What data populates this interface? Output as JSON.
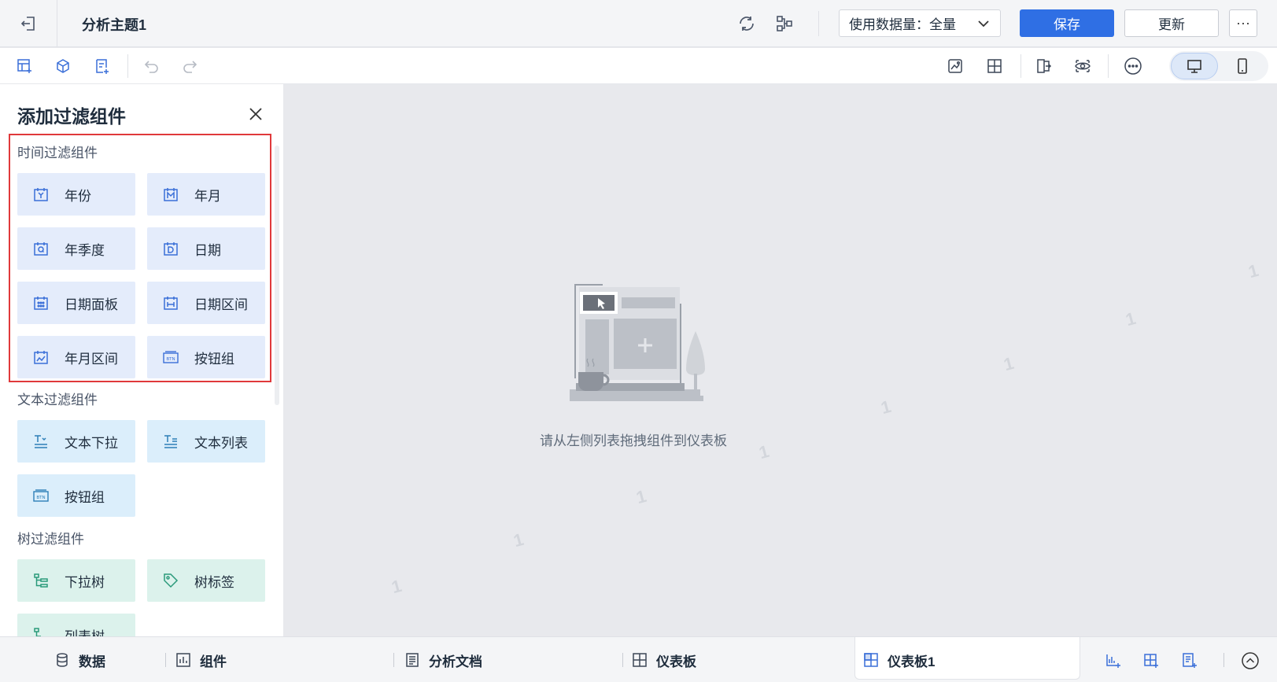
{
  "header": {
    "title": "分析主题1",
    "data_amount_label": "使用数据量：全量",
    "save_label": "保存",
    "update_label": "更新",
    "more_label": "···"
  },
  "panel": {
    "title": "添加过滤组件",
    "sections": {
      "time": {
        "label": "时间过滤组件",
        "items": [
          "年份",
          "年月",
          "年季度",
          "日期",
          "日期面板",
          "日期区间",
          "年月区间",
          "按钮组"
        ]
      },
      "text": {
        "label": "文本过滤组件",
        "items": [
          "文本下拉",
          "文本列表",
          "按钮组"
        ]
      },
      "tree": {
        "label": "树过滤组件",
        "items": [
          "下拉树",
          "树标签",
          "列表树"
        ]
      }
    }
  },
  "canvas": {
    "empty_text": "请从左侧列表拖拽组件到仪表板",
    "watermark": "1"
  },
  "bottom": {
    "tabs": [
      "数据",
      "组件",
      "分析文档",
      "仪表板",
      "仪表板1"
    ]
  },
  "colors": {
    "primary": "#2f6fe4",
    "highlight_border": "#e0393b",
    "time_tile": "#e4ecfb",
    "text_tile": "#dbeefb",
    "tree_tile": "#dcf2ec"
  }
}
